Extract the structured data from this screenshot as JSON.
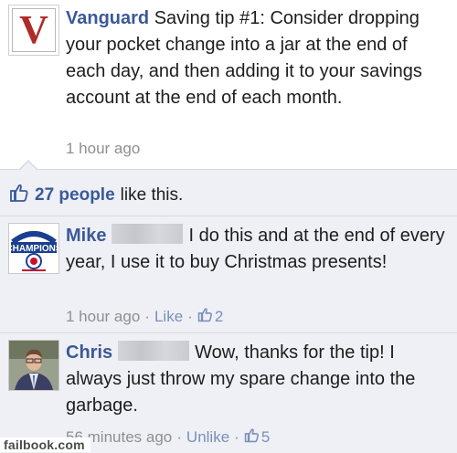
{
  "post": {
    "author": "Vanguard",
    "text": "Saving tip #1: Consider dropping your pocket change into a jar at the end of each day, and then adding it to your savings account at the end of each month.",
    "time": "1 hour ago",
    "avatar_letter": "V",
    "avatar_icon": "vanguard-logo"
  },
  "likes": {
    "count": "27 people",
    "suffix": "like this.",
    "icon": "thumbs-up-icon"
  },
  "comments": [
    {
      "name": "Mike",
      "text": "I do this and at the end of every year, I use it to buy Christmas presents!",
      "time": "1 hour ago",
      "action": "Like",
      "likes": "2",
      "avatar_icon": "champions-logo"
    },
    {
      "name": "Chris",
      "text": "Wow, thanks for the tip! I always just throw my spare change into the garbage.",
      "time": "56 minutes ago",
      "action": "Unlike",
      "likes": "5",
      "avatar_icon": "user-photo"
    }
  ],
  "colors": {
    "link": "#3b5998",
    "feedback_bg": "#eef0f5",
    "meta": "#8f8f8f",
    "vanguard_red": "#b02a2a"
  },
  "watermark": "failbook.com"
}
